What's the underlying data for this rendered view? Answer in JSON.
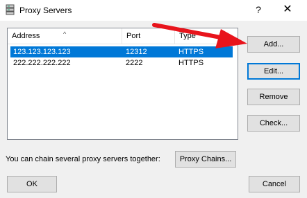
{
  "window": {
    "title": "Proxy Servers",
    "help_glyph": "?",
    "close_glyph": "✕"
  },
  "list": {
    "columns": [
      "Address",
      "Port",
      "Type"
    ],
    "sort_indicator": "^",
    "rows": [
      {
        "address": "123.123.123.123",
        "port": "12312",
        "type": "HTTPS",
        "selected": true
      },
      {
        "address": "222.222.222.222",
        "port": "2222",
        "type": "HTTPS",
        "selected": false
      }
    ]
  },
  "buttons": {
    "add": "Add...",
    "edit": "Edit...",
    "remove": "Remove",
    "check": "Check...",
    "proxy_chains": "Proxy Chains...",
    "ok": "OK",
    "cancel": "Cancel"
  },
  "chain_text": "You can chain several proxy servers together:",
  "colors": {
    "selection": "#0078d7",
    "arrow": "#e8141c"
  }
}
